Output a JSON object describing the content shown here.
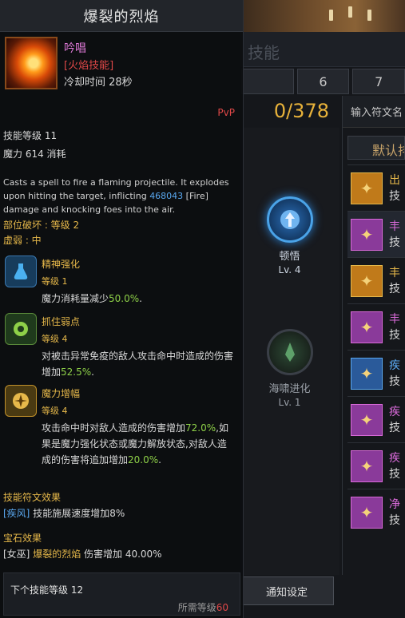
{
  "tooltip": {
    "title": "爆裂的烈焰",
    "type_label": "吟唱",
    "tag": "[火焰技能]",
    "cooldown": "冷却时间 28秒",
    "pvp": "PvP",
    "skill_level": "技能等级 11",
    "mana": "魔力 614 消耗",
    "description_pre": "Casts a spell to fire a flaming projectile. It explodes upon hitting the target, inflicting ",
    "description_num": "468043",
    "description_post": " [Fire] damage and knocking foes into the air.",
    "part_break": "部位破坏 : 等级 2",
    "weakness": "虚弱 : 中",
    "tripods": [
      {
        "name": "精神强化",
        "level": "等级 1",
        "effect_pre": "魔力消耗量减少",
        "effect_val": "50.0%",
        "effect_post": ".",
        "icon": "mana-flask-icon"
      },
      {
        "name": "抓住弱点",
        "level": "等级 4",
        "effect_pre": "对被击异常免疫的敌人攻击命中时造成的伤害增加",
        "effect_val": "52.5%",
        "effect_post": ".",
        "icon": "weakpoint-icon"
      },
      {
        "name": "魔力增幅",
        "level": "等级 4",
        "effect_pre": "攻击命中时对敌人造成的伤害增加",
        "effect_val": "72.0%",
        "effect_mid": ",如果是魔力强化状态或魔力解放状态,对敌人造成的伤害将追加增加",
        "effect_val2": "20.0%",
        "effect_post": ".",
        "icon": "mana-amplify-icon"
      }
    ],
    "rune_title": "技能符文效果",
    "rune_name": "[疾风]",
    "rune_effect": " 技能施展速度增加8%",
    "gem_title": "宝石效果",
    "gem_prefix": "[女巫] ",
    "gem_skill": "爆裂的烈焰",
    "gem_effect": " 伤害增加 40.00%",
    "next_level": "下个技能等级 12",
    "required_prefix": "所需等级",
    "required_level": "60"
  },
  "background": {
    "header_title": "技能",
    "tabs": [
      "",
      "6",
      "7"
    ],
    "points": "0/378",
    "nodes": [
      {
        "name": "顿悟",
        "level": "Lv. 4"
      },
      {
        "name": "海啸进化",
        "level": "Lv. 1"
      }
    ],
    "notify_button": "通知设定",
    "rune_search_placeholder": "输入符文名",
    "rune_filter": "默认排",
    "runes": [
      {
        "label": "出",
        "sub": "技",
        "color": "#e6b84a",
        "frame": "#c07a1a"
      },
      {
        "label": "丰",
        "sub": "技",
        "color": "#d86ad8",
        "frame": "#8a3a9a"
      },
      {
        "label": "丰",
        "sub": "技",
        "color": "#e6b84a",
        "frame": "#c07a1a"
      },
      {
        "label": "丰",
        "sub": "技",
        "color": "#d86ad8",
        "frame": "#8a3a9a"
      },
      {
        "label": "疾",
        "sub": "技",
        "color": "#5aa8f0",
        "frame": "#2a5a9a"
      },
      {
        "label": "疾",
        "sub": "技",
        "color": "#d86ad8",
        "frame": "#8a3a9a"
      },
      {
        "label": "疾",
        "sub": "技",
        "color": "#d86ad8",
        "frame": "#8a3a9a"
      },
      {
        "label": "净",
        "sub": "技",
        "color": "#d86ad8",
        "frame": "#8a3a9a"
      }
    ]
  }
}
